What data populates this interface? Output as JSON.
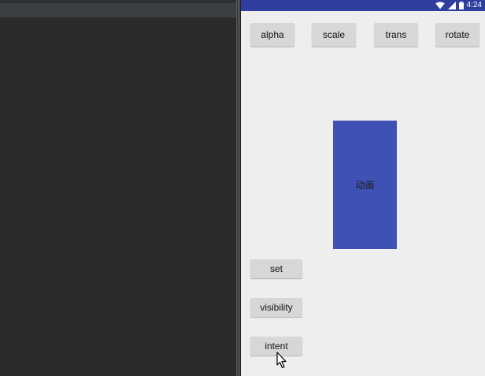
{
  "status_bar": {
    "time": "4:24",
    "icons": [
      "wifi-icon",
      "signal-icon",
      "battery-icon"
    ],
    "color": "#303f9f"
  },
  "top_buttons": [
    "alpha",
    "scale",
    "trans",
    "rotate"
  ],
  "animated_view": {
    "label": "动画",
    "color": "#3f51b5"
  },
  "side_buttons": [
    "set",
    "visibility",
    "intent"
  ],
  "colors": {
    "background": "#eeeeee",
    "button": "#d6d7d7",
    "ide_background": "#2b2b2b"
  }
}
